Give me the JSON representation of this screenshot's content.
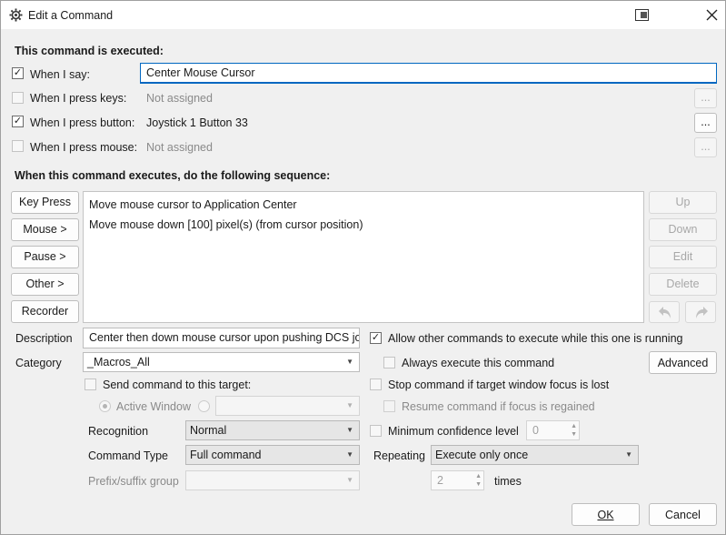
{
  "window": {
    "title": "Edit a Command",
    "icons": {
      "app": "gear-icon",
      "restore": "restore-window-icon",
      "close": "close-icon"
    }
  },
  "executed": {
    "heading": "This command is executed:",
    "when_say": {
      "label": "When I say:",
      "checked": true,
      "value": "Center Mouse Cursor"
    },
    "when_keys": {
      "label": "When I press keys:",
      "checked": false,
      "value": "Not assigned",
      "btn": "..."
    },
    "when_button": {
      "label": "When I press button:",
      "checked": true,
      "value": "Joystick 1 Button 33",
      "btn": "..."
    },
    "when_mouse": {
      "label": "When I press mouse:",
      "checked": false,
      "value": "Not assigned",
      "btn": "..."
    }
  },
  "sequence": {
    "heading": "When this command executes, do the following sequence:",
    "left_buttons": {
      "key_press": "Key Press",
      "mouse": "Mouse >",
      "pause": "Pause >",
      "other": "Other >",
      "recorder": "Recorder"
    },
    "items": [
      "Move mouse cursor to Application Center",
      "Move mouse down [100] pixel(s) (from cursor position)"
    ],
    "right_buttons": {
      "up": "Up",
      "down": "Down",
      "edit": "Edit",
      "delete": "Delete"
    },
    "icons": {
      "undo": "undo-icon",
      "redo": "redo-icon"
    }
  },
  "details": {
    "description_label": "Description",
    "description_value": "Center then down mouse cursor upon pushing DCS joy",
    "category_label": "Category",
    "category_value": "_Macros_All",
    "allow_other": {
      "label": "Allow other commands to execute while this one is running",
      "checked": true
    },
    "always_execute": {
      "label": "Always execute this command",
      "checked": false
    },
    "advanced": "Advanced",
    "send_target": {
      "label": "Send command to this target:",
      "checked": false
    },
    "active_window": "Active Window",
    "stop_focus": {
      "label": "Stop command if target window focus is lost",
      "checked": false
    },
    "resume_focus": {
      "label": "Resume command if focus is regained",
      "checked": false
    },
    "recognition_label": "Recognition",
    "recognition_value": "Normal",
    "min_conf": {
      "label": "Minimum confidence level",
      "checked": false,
      "value": "0"
    },
    "command_type_label": "Command Type",
    "command_type_value": "Full command",
    "repeating_label": "Repeating",
    "repeating_value": "Execute only once",
    "prefix_label": "Prefix/suffix group",
    "prefix_value": "",
    "times_value": "2",
    "times_label": "times"
  },
  "footer": {
    "ok": "OK",
    "cancel": "Cancel"
  }
}
